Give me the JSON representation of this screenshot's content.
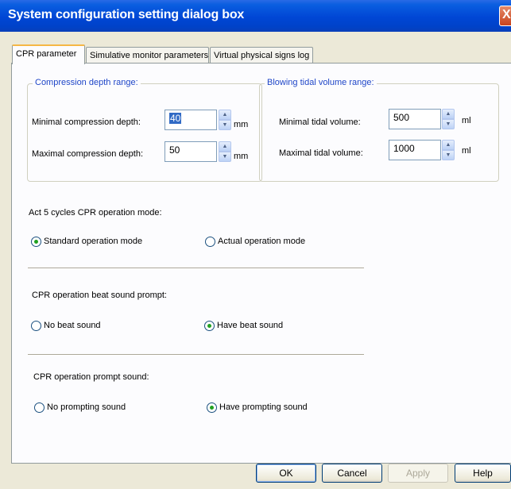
{
  "window": {
    "title": "System configuration setting dialog box",
    "close_glyph": "X"
  },
  "tabs": [
    {
      "label": "CPR parameter",
      "active": true
    },
    {
      "label": "Simulative monitor parameters",
      "active": false
    },
    {
      "label": "Virtual physical signs log",
      "active": false
    }
  ],
  "compression": {
    "title": "Compression depth range:",
    "min_label": "Minimal compression depth:",
    "min_value": "40",
    "max_label": "Maximal compression depth:",
    "max_value": "50",
    "unit": "mm"
  },
  "tidal": {
    "title": "Blowing tidal volume range:",
    "min_label": "Minimal tidal volume:",
    "min_value": "500",
    "max_label": "Maximal tidal volume:",
    "max_value": "1000",
    "unit": "ml"
  },
  "mode": {
    "heading": "Act 5 cycles CPR operation mode:",
    "option_standard": "Standard operation mode",
    "option_actual": "Actual operation mode",
    "selected": "standard"
  },
  "beat": {
    "heading": "CPR operation beat sound prompt:",
    "option_none": "No beat sound",
    "option_have": "Have beat sound",
    "selected": "have"
  },
  "prompt": {
    "heading": "CPR operation prompt sound:",
    "option_none": "No prompting sound",
    "option_have": "Have prompting sound",
    "selected": "have"
  },
  "buttons": {
    "ok": "OK",
    "cancel": "Cancel",
    "apply": "Apply",
    "help": "Help"
  },
  "icons": {
    "spin_up": "▲",
    "spin_down": "▼"
  }
}
